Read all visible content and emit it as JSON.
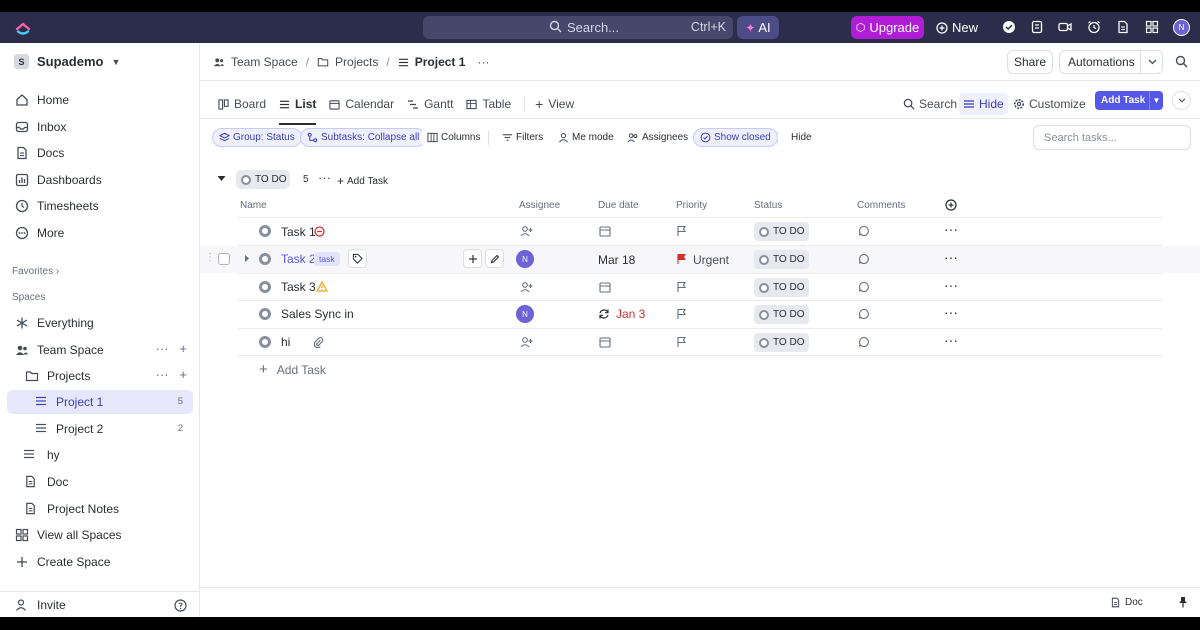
{
  "topbar": {
    "search_text": "Search...",
    "search_shortcut": "Ctrl+K",
    "ai_label": "AI",
    "upgrade_label": "Upgrade",
    "new_label": "New",
    "avatar_initial": "N"
  },
  "sidebar": {
    "workspace_badge": "S",
    "workspace_name": "Supademo",
    "nav": [
      {
        "label": "Home",
        "icon": "home-icon"
      },
      {
        "label": "Inbox",
        "icon": "inbox-icon"
      },
      {
        "label": "Docs",
        "icon": "docs-icon"
      },
      {
        "label": "Dashboards",
        "icon": "dashboards-icon"
      },
      {
        "label": "Timesheets",
        "icon": "timesheets-icon"
      },
      {
        "label": "More",
        "icon": "more-icon"
      }
    ],
    "favorites_label": "Favorites",
    "spaces_label": "Spaces",
    "spaces": [
      {
        "label": "Everything",
        "icon": "everything-icon"
      },
      {
        "label": "Team Space",
        "icon": "team-icon"
      },
      {
        "label": "Projects",
        "icon": "folder-icon"
      },
      {
        "label": "Project 1",
        "count": "5",
        "icon": "list-icon"
      },
      {
        "label": "Project 2",
        "count": "2",
        "icon": "list-icon"
      },
      {
        "label": "hy",
        "icon": "list-icon"
      },
      {
        "label": "Doc",
        "icon": "doc-icon"
      },
      {
        "label": "Project Notes",
        "icon": "doc-icon"
      },
      {
        "label": "View all Spaces",
        "icon": "grid-icon"
      },
      {
        "label": "Create Space",
        "icon": "plus-icon"
      }
    ],
    "invite_label": "Invite"
  },
  "header": {
    "breadcrumb": [
      "Team Space",
      "Projects",
      "Project 1"
    ],
    "share_label": "Share",
    "automations_label": "Automations"
  },
  "views": {
    "tabs": [
      "Board",
      "List",
      "Calendar",
      "Gantt",
      "Table"
    ],
    "add_view_label": "View",
    "search_label": "Search",
    "hide_label": "Hide",
    "customize_label": "Customize",
    "add_task_label": "Add Task"
  },
  "filters": {
    "group": "Group: Status",
    "subtasks": "Subtasks: Collapse all",
    "columns": "Columns",
    "filters": "Filters",
    "me_mode": "Me mode",
    "assignees": "Assignees",
    "show_closed": "Show closed",
    "hide": "Hide",
    "search_placeholder": "Search tasks..."
  },
  "group": {
    "status": "TO DO",
    "count": "5",
    "add_task_label": "Add Task"
  },
  "columns": [
    "Name",
    "Assignee",
    "Due date",
    "Priority",
    "Status",
    "Comments"
  ],
  "tasks": [
    {
      "name": "Task 1",
      "assignee": "",
      "due": "",
      "priority": "",
      "status": "TO DO"
    },
    {
      "name": "Task 2",
      "tag": "task",
      "assignee": "N",
      "due": "Mar 18",
      "priority": "Urgent",
      "status": "TO DO"
    },
    {
      "name": "Task 3",
      "assignee": "",
      "due": "",
      "priority": "",
      "status": "TO DO"
    },
    {
      "name": "Sales Sync in",
      "assignee": "N",
      "due": "Jan 3",
      "priority": "",
      "status": "TO DO"
    },
    {
      "name": "hi",
      "assignee": "",
      "due": "",
      "priority": "",
      "status": "TO DO"
    }
  ],
  "add_task_row_label": "Add Task",
  "footer": {
    "doc_label": "Doc"
  },
  "colors": {
    "accent": "#5558e6",
    "topbar": "#2c2d4a",
    "upgrade": "#b11dd6",
    "urgent": "#d0312d",
    "overdue": "#d0312d"
  }
}
